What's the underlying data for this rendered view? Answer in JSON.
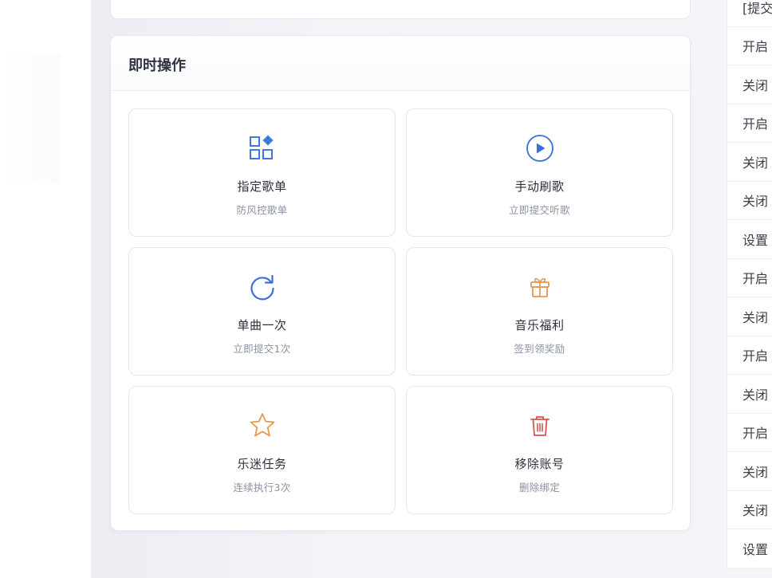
{
  "quick_actions": {
    "title": "即时操作",
    "items": [
      {
        "label": "指定歌单",
        "desc": "防风控歌单",
        "icon": "apps-grid-icon",
        "color": "#3b7be0"
      },
      {
        "label": "手动刷歌",
        "desc": "立即提交听歌",
        "icon": "play-circle-icon",
        "color": "#3b6fe0"
      },
      {
        "label": "单曲一次",
        "desc": "立即提交1次",
        "icon": "refresh-icon",
        "color": "#3b6fe0"
      },
      {
        "label": "音乐福利",
        "desc": "签到领奖励",
        "icon": "gift-icon",
        "color": "#e39a52"
      },
      {
        "label": "乐迷任务",
        "desc": "连续执行3次",
        "icon": "star-icon",
        "color": "#e39a52"
      },
      {
        "label": "移除账号",
        "desc": "删除绑定",
        "icon": "trash-icon",
        "color": "#d9534f"
      }
    ]
  },
  "log": {
    "items": [
      "[提交",
      "开启",
      "关闭",
      "开启",
      "关闭",
      "关闭",
      "设置",
      "开启",
      "关闭",
      "开启",
      "关闭",
      "开启",
      "关闭",
      "关闭",
      "设置"
    ]
  }
}
